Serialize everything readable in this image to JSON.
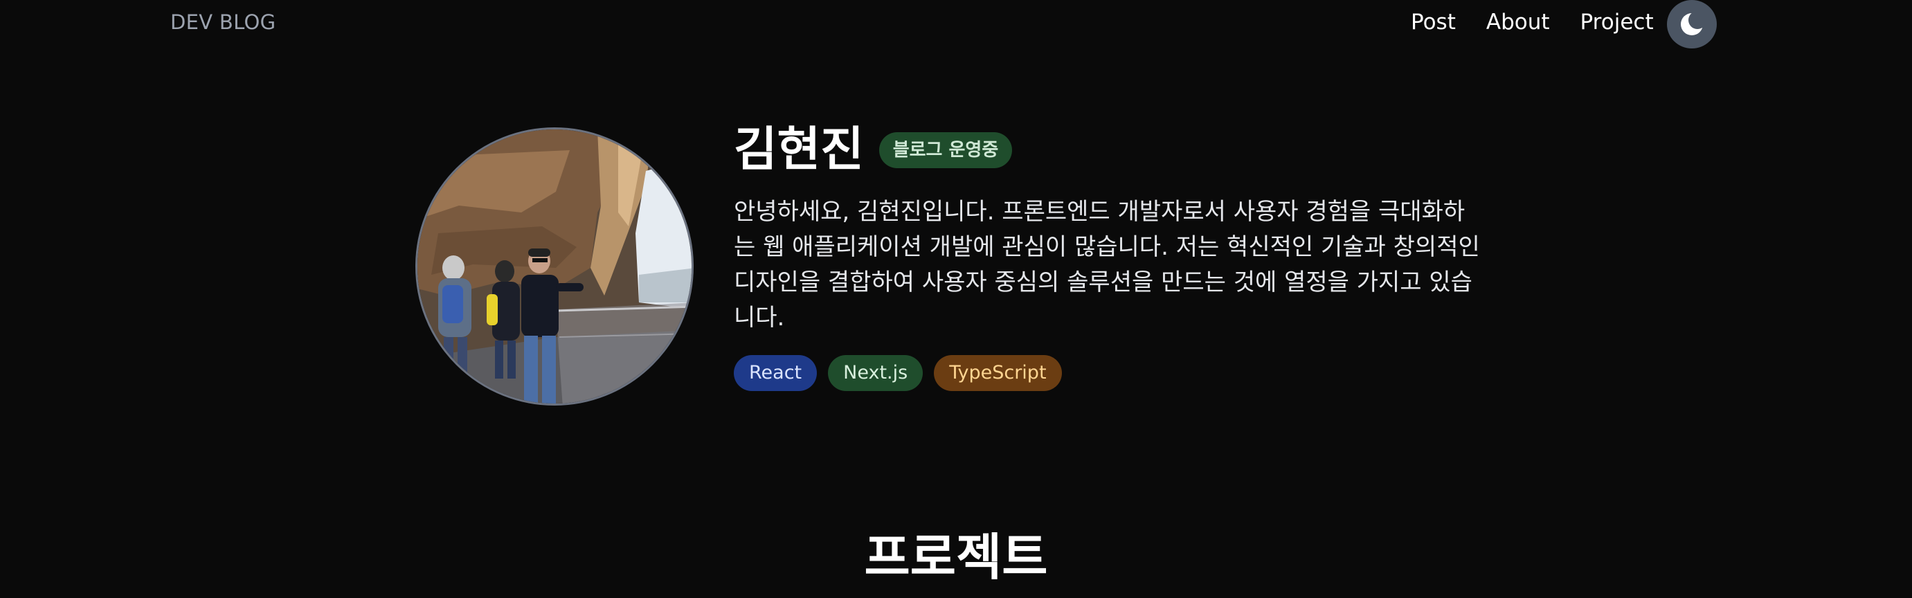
{
  "header": {
    "brand": "DEV BLOG",
    "nav": [
      {
        "label": "Post"
      },
      {
        "label": "About"
      },
      {
        "label": "Project"
      }
    ],
    "theme_toggle_icon": "moon-icon"
  },
  "profile": {
    "name": "김현진",
    "status_badge": "블로그 운영중",
    "intro": "안녕하세요, 김현진입니다. 프론트엔드 개발자로서 사용자 경험을 극대화하는 웹 애플리케이션 개발에 관심이 많습니다. 저는 혁신적인 기술과 창의적인 디자인을 결합하여 사용자 중심의 솔루션을 만드는 것에 열정을 가지고 있습니다.",
    "tags": [
      {
        "label": "React",
        "color": "#1e3a8a"
      },
      {
        "label": "Next.js",
        "color": "#1f4d2c"
      },
      {
        "label": "TypeScript",
        "color": "#6b3d12"
      }
    ]
  },
  "sections": {
    "projects_title": "프로젝트"
  },
  "colors": {
    "background": "#0a0a0a",
    "muted_text": "#9ca3af",
    "toggle_bg": "#4b5563"
  }
}
